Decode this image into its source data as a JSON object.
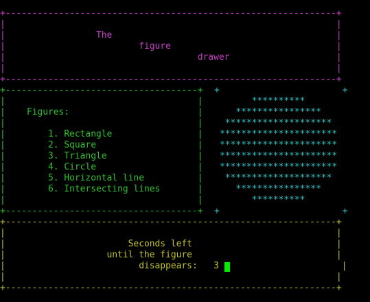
{
  "colors": {
    "background": "#000000",
    "title_box": "#c040c0",
    "menu_box": "#30c030",
    "figure": "#30c0c0",
    "timer_box": "#c0c030",
    "cursor": "#00ee00"
  },
  "title_box": {
    "rows": [
      "+--------------------------------------------------------------+",
      "|                                                              |",
      "|                 The                                          |",
      "|                         figure                               |",
      "|                                    drawer                    |",
      "|                                                              |",
      "+--------------------------------------------------------------+"
    ]
  },
  "menu_box": {
    "rows": [
      "+------------------------------------+",
      "|                                    |",
      "|    Figures:                        |",
      "|                                    |",
      "|        1. Rectangle                |",
      "|        2. Square                   |",
      "|        3. Triangle                 |",
      "|        4. Circle                   |",
      "|        5. Horizontal line          |",
      "|        6. Intersecting lines       |",
      "|                                    |",
      "+------------------------------------+"
    ]
  },
  "figure_area": {
    "corner_top": "+                       +",
    "rows": [
      "      **********",
      "   ****************",
      " ********************",
      "**********************",
      "**********************",
      "**********************",
      "**********************",
      " ********************",
      "   ****************",
      "      **********"
    ],
    "corner_bottom": "+                       +"
  },
  "timer_box": {
    "rows": [
      "+--------------------------------------------------------------+",
      "|                                                              |",
      "|                       Seconds left                           |",
      "|                   until the figure                           |",
      "|                         disappears:   3                       |",
      "|                                                              |",
      "|                                                              |",
      "+--------------------------------------------------------------+"
    ]
  }
}
